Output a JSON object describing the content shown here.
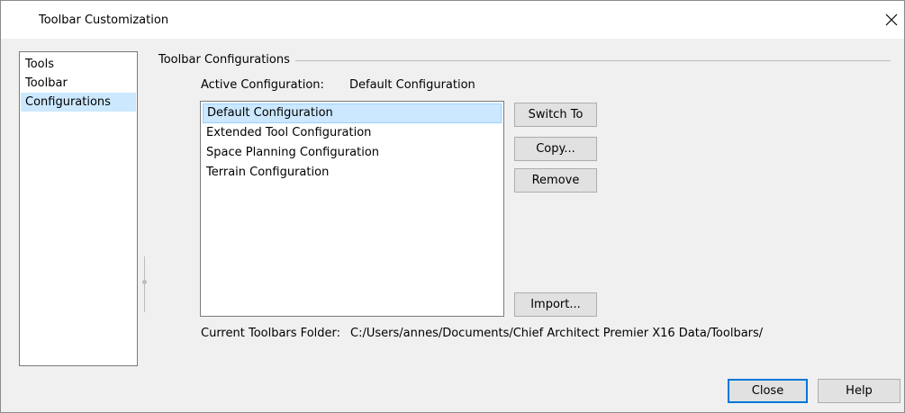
{
  "window": {
    "title": "Toolbar Customization",
    "close_glyph": "✕"
  },
  "nav": {
    "items": [
      {
        "label": "Tools",
        "selected": false
      },
      {
        "label": "Toolbar",
        "selected": false
      },
      {
        "label": "Configurations",
        "selected": true
      }
    ]
  },
  "group": {
    "title": "Toolbar Configurations",
    "active_label": "Active Configuration:",
    "active_value": "Default Configuration",
    "configurations": [
      {
        "label": "Default Configuration",
        "selected": true
      },
      {
        "label": "Extended Tool Configuration",
        "selected": false
      },
      {
        "label": "Space Planning Configuration",
        "selected": false
      },
      {
        "label": "Terrain Configuration",
        "selected": false
      }
    ],
    "buttons": {
      "switch_to": "Switch To",
      "copy": "Copy...",
      "remove": "Remove",
      "import": "Import..."
    },
    "folder_label": "Current Toolbars Folder:",
    "folder_path": "C:/Users/annes/Documents/Chief Architect Premier X16 Data/Toolbars/"
  },
  "footer": {
    "close": "Close",
    "help": "Help"
  },
  "colors": {
    "selection": "#cce8ff",
    "default_button_border": "#0078d7"
  }
}
